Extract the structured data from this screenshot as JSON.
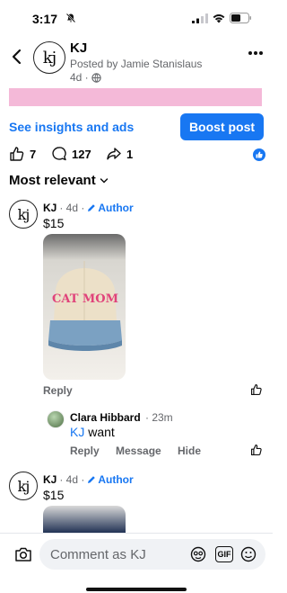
{
  "status_bar": {
    "time": "3:17"
  },
  "header": {
    "avatar_text": "kj",
    "page_name": "KJ",
    "posted_by": "Posted by Jamie Stanislaus",
    "age": "4d ·"
  },
  "insights_link": "See insights and ads",
  "boost_button": "Boost post",
  "stats": {
    "likes": "7",
    "comments": "127",
    "shares": "1"
  },
  "sort_label": "Most relevant",
  "comments": [
    {
      "avatar_text": "kj",
      "name": "KJ",
      "age": "· 4d ·",
      "badge": "Author",
      "text": "$15",
      "photo_text": "CAT MOM",
      "reply_label": "Reply"
    },
    {
      "avatar_text": "kj",
      "name": "KJ",
      "age": "· 4d ·",
      "badge": "Author",
      "text": "$15"
    }
  ],
  "reply": {
    "name": "Clara Hibbard",
    "age": "· 23m",
    "mention": "KJ",
    "text": "want",
    "actions": [
      "Reply",
      "Message",
      "Hide"
    ]
  },
  "composer": {
    "placeholder": "Comment as KJ",
    "gif_label": "GIF"
  },
  "colors": {
    "accent": "#1877f2",
    "pink_strip": "#f4b9d8",
    "muted": "#65676b"
  }
}
